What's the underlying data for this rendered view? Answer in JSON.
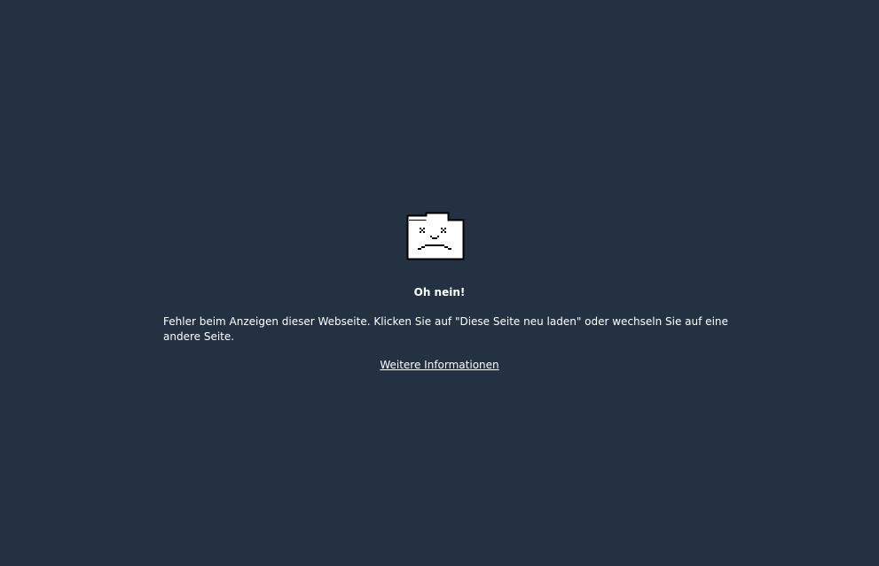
{
  "error_page": {
    "icon": "sad-folder-icon",
    "title": "Oh nein!",
    "message": "Fehler beim Anzeigen dieser Webseite. Klicken Sie auf \"Diese Seite neu laden\" oder wechseln Sie auf eine andere Seite.",
    "learn_more_label": "Weitere Informationen"
  },
  "colors": {
    "background": "#233142",
    "text": "#ffffff",
    "icon_fill": "#ffffff",
    "icon_outline": "#000000"
  }
}
